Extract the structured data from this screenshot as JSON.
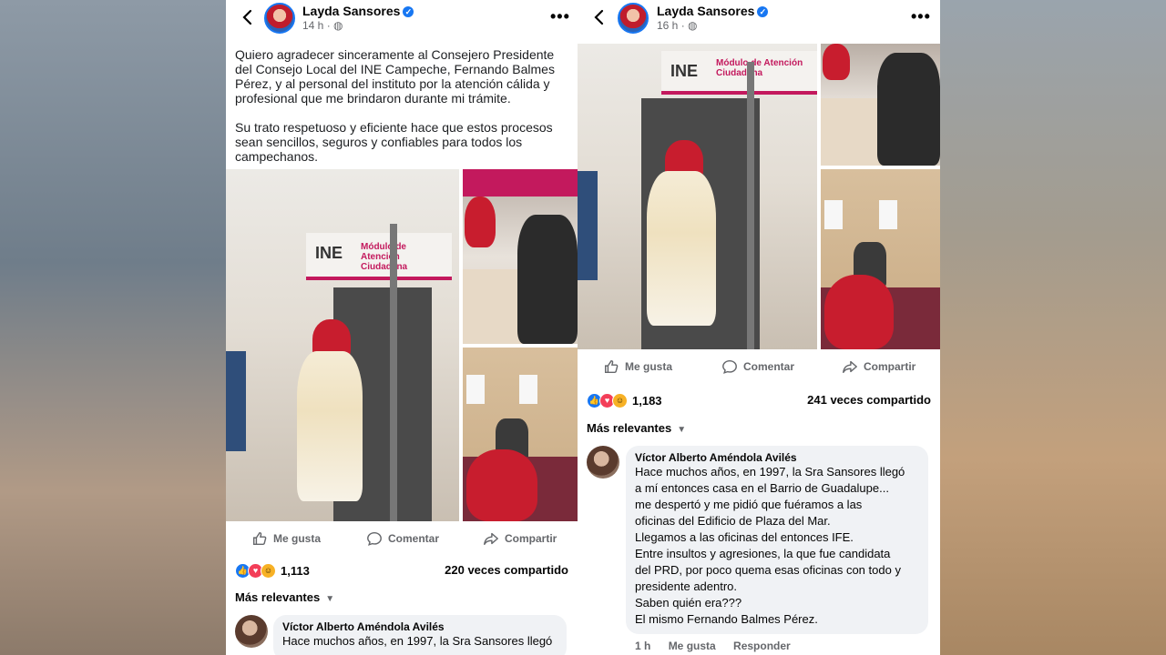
{
  "left_post": {
    "author": "Layda Sansores",
    "time": "14 h",
    "text_paragraphs": [
      "Quiero agradecer sinceramente al Consejero Presidente del Consejo Local del INE Campeche, Fernando Balmes Pérez, y al personal del instituto por la atención cálida y profesional que me brindaron durante mi trámite.",
      "Su trato respetuoso y eficiente hace que estos procesos sean sencillos, seguros y confiables para todos los campechanos."
    ],
    "sign_text": "INE",
    "sign_sub": "Módulo de Atención Ciudadana",
    "actions": {
      "like": "Me gusta",
      "comment": "Comentar",
      "share": "Compartir"
    },
    "reaction_count": "1,113",
    "shares": "220 veces compartido",
    "sort_label": "Más relevantes",
    "comment": {
      "author": "Víctor Alberto Améndola Avilés",
      "text": "Hace muchos años, en 1997, la Sra Sansores llegó"
    }
  },
  "right_post": {
    "author": "Layda Sansores",
    "time": "16 h",
    "sign_text": "INE",
    "sign_sub": "Módulo de Atención Ciudadana",
    "actions": {
      "like": "Me gusta",
      "comment": "Comentar",
      "share": "Compartir"
    },
    "reaction_count": "1,183",
    "shares": "241 veces compartido",
    "sort_label": "Más relevantes",
    "comment": {
      "author": "Víctor Alberto Améndola Avilés",
      "text": "Hace muchos años, en 1997, la Sra Sansores llegó\na mí entonces casa en el Barrio de Guadalupe...\nme despertó y me pidió que fuéramos a las\noficinas del Edificio de Plaza del Mar.\nLlegamos a las oficinas del entonces IFE.\nEntre insultos y agresiones, la que fue candidata\ndel PRD, por poco quema esas oficinas con todo y\npresidente adentro.\nSaben quién era???\nEl mismo Fernando Balmes Pérez.",
      "time": "1 h",
      "like": "Me gusta",
      "reply": "Responder"
    }
  },
  "icons": [
    "back-arrow-icon",
    "verified-icon",
    "globe-icon",
    "more-dots-icon",
    "like-icon",
    "comment-icon",
    "share-icon",
    "love-reaction-icon",
    "haha-reaction-icon",
    "chevron-down-icon"
  ],
  "colors": {
    "facebook_blue": "#1877f2",
    "ine_magenta": "#c3195d",
    "gray_text": "#65676b"
  }
}
